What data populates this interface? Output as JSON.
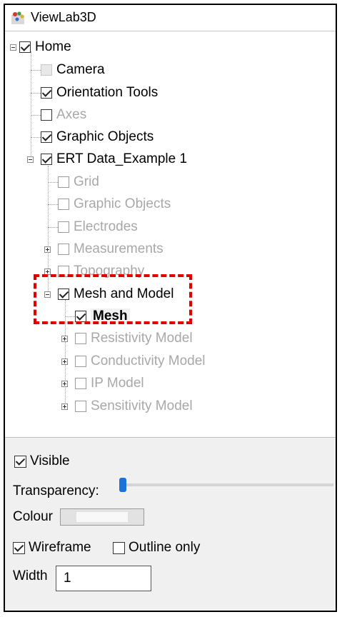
{
  "window": {
    "title": "ViewLab3D",
    "icon": "app-logo-icon"
  },
  "tree": {
    "items": [
      {
        "label": "Home",
        "checked": true
      },
      {
        "label": "Camera",
        "checked": false
      },
      {
        "label": "Orientation Tools",
        "checked": true
      },
      {
        "label": "Axes",
        "checked": false
      },
      {
        "label": "Graphic Objects",
        "checked": true
      },
      {
        "label": "ERT Data_Example 1",
        "checked": true
      },
      {
        "label": "Grid",
        "checked": false
      },
      {
        "label": "Graphic Objects",
        "checked": false
      },
      {
        "label": "Electrodes",
        "checked": false
      },
      {
        "label": "Measurements",
        "checked": false
      },
      {
        "label": "Topography",
        "checked": false
      },
      {
        "label": "Mesh and Model",
        "checked": true
      },
      {
        "label": "Mesh",
        "checked": true,
        "selected": true
      },
      {
        "label": "Resistivity Model",
        "checked": false
      },
      {
        "label": "Conductivity Model",
        "checked": false
      },
      {
        "label": "IP Model",
        "checked": false
      },
      {
        "label": "Sensitivity Model",
        "checked": false
      }
    ]
  },
  "properties": {
    "visible_label": "Visible",
    "visible_checked": true,
    "transparency_label": "Transparency:",
    "transparency_value": 0,
    "colour_label": "Colour",
    "wireframe_label": "Wireframe",
    "wireframe_checked": true,
    "outline_label": "Outline only",
    "outline_checked": false,
    "width_label": "Width",
    "width_value": "1"
  },
  "colors": {
    "highlight": "#e00000",
    "slider_thumb": "#1a73d9",
    "panel_bg": "#f0f0f0"
  }
}
